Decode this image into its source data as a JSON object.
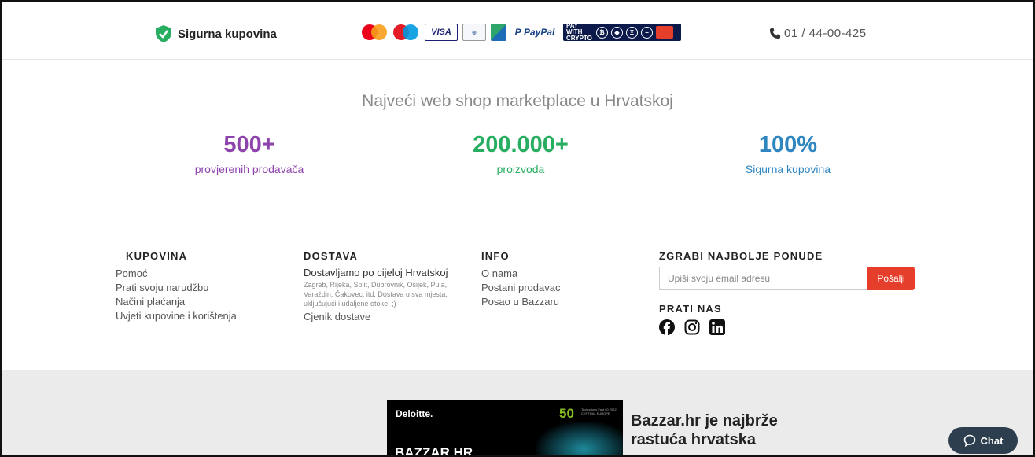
{
  "topbar": {
    "secure_label": "Sigurna kupovina",
    "payment_icons": [
      "mastercard-icon",
      "maestro-icon",
      "visa-icon",
      "diners-club-icon",
      "gj-icon",
      "paypal-icon",
      "pay-with-crypto-icon"
    ],
    "visa_text": "VISA",
    "paypal_text": "PayPal",
    "crypto_text": "PAY WITH CRYPTO",
    "phone": "01 / 44-00-425"
  },
  "stats": {
    "tagline": "Najveći web shop marketplace u Hrvatskoj",
    "items": [
      {
        "value": "500+",
        "label": "provjerenih prodavača",
        "color": "#8e44ad"
      },
      {
        "value": "200.000+",
        "label": "proizvoda",
        "color": "#27ae60"
      },
      {
        "value": "100%",
        "label": "Sigurna kupovina",
        "color": "#2e86c1"
      }
    ]
  },
  "footer": {
    "kupovina": {
      "title": "KUPOVINA",
      "links": [
        "Pomoć",
        "Prati svoju narudžbu",
        "Načini plaćanja",
        "Uvjeti kupovine i korištenja"
      ]
    },
    "dostava": {
      "title": "DOSTAVA",
      "subtitle": "Dostavljamo po cijeloj Hrvatskoj",
      "cities": "Zagreb, Rijeka, Split, Dubrovnik, Osijek, Pula, Varaždin, Čakovec, itd. Dostava u sva mjesta, uključujući i udaljene otoke! ;)",
      "link": "Cjenik dostave"
    },
    "info": {
      "title": "INFO",
      "links": [
        "O nama",
        "Postani prodavac",
        "Posao u Bazzaru"
      ]
    },
    "newsletter": {
      "title": "ZGRABI NAJBOLJE PONUDE",
      "placeholder": "Upiši svoju email adresu",
      "button": "Pošalji",
      "follow_title": "PRATI NAS",
      "socials": [
        "facebook-icon",
        "instagram-icon",
        "linkedin-icon"
      ]
    }
  },
  "bottom": {
    "badge_brand": "Deloitte.",
    "badge_number": "50",
    "badge_small": "Technology Fast 50 2022 CENTRAL EUROPE",
    "badge_title": "BAZZAR.HR",
    "headline": "Bazzar.hr je najbrže rastuća hrvatska"
  },
  "chat": {
    "label": "Chat"
  }
}
